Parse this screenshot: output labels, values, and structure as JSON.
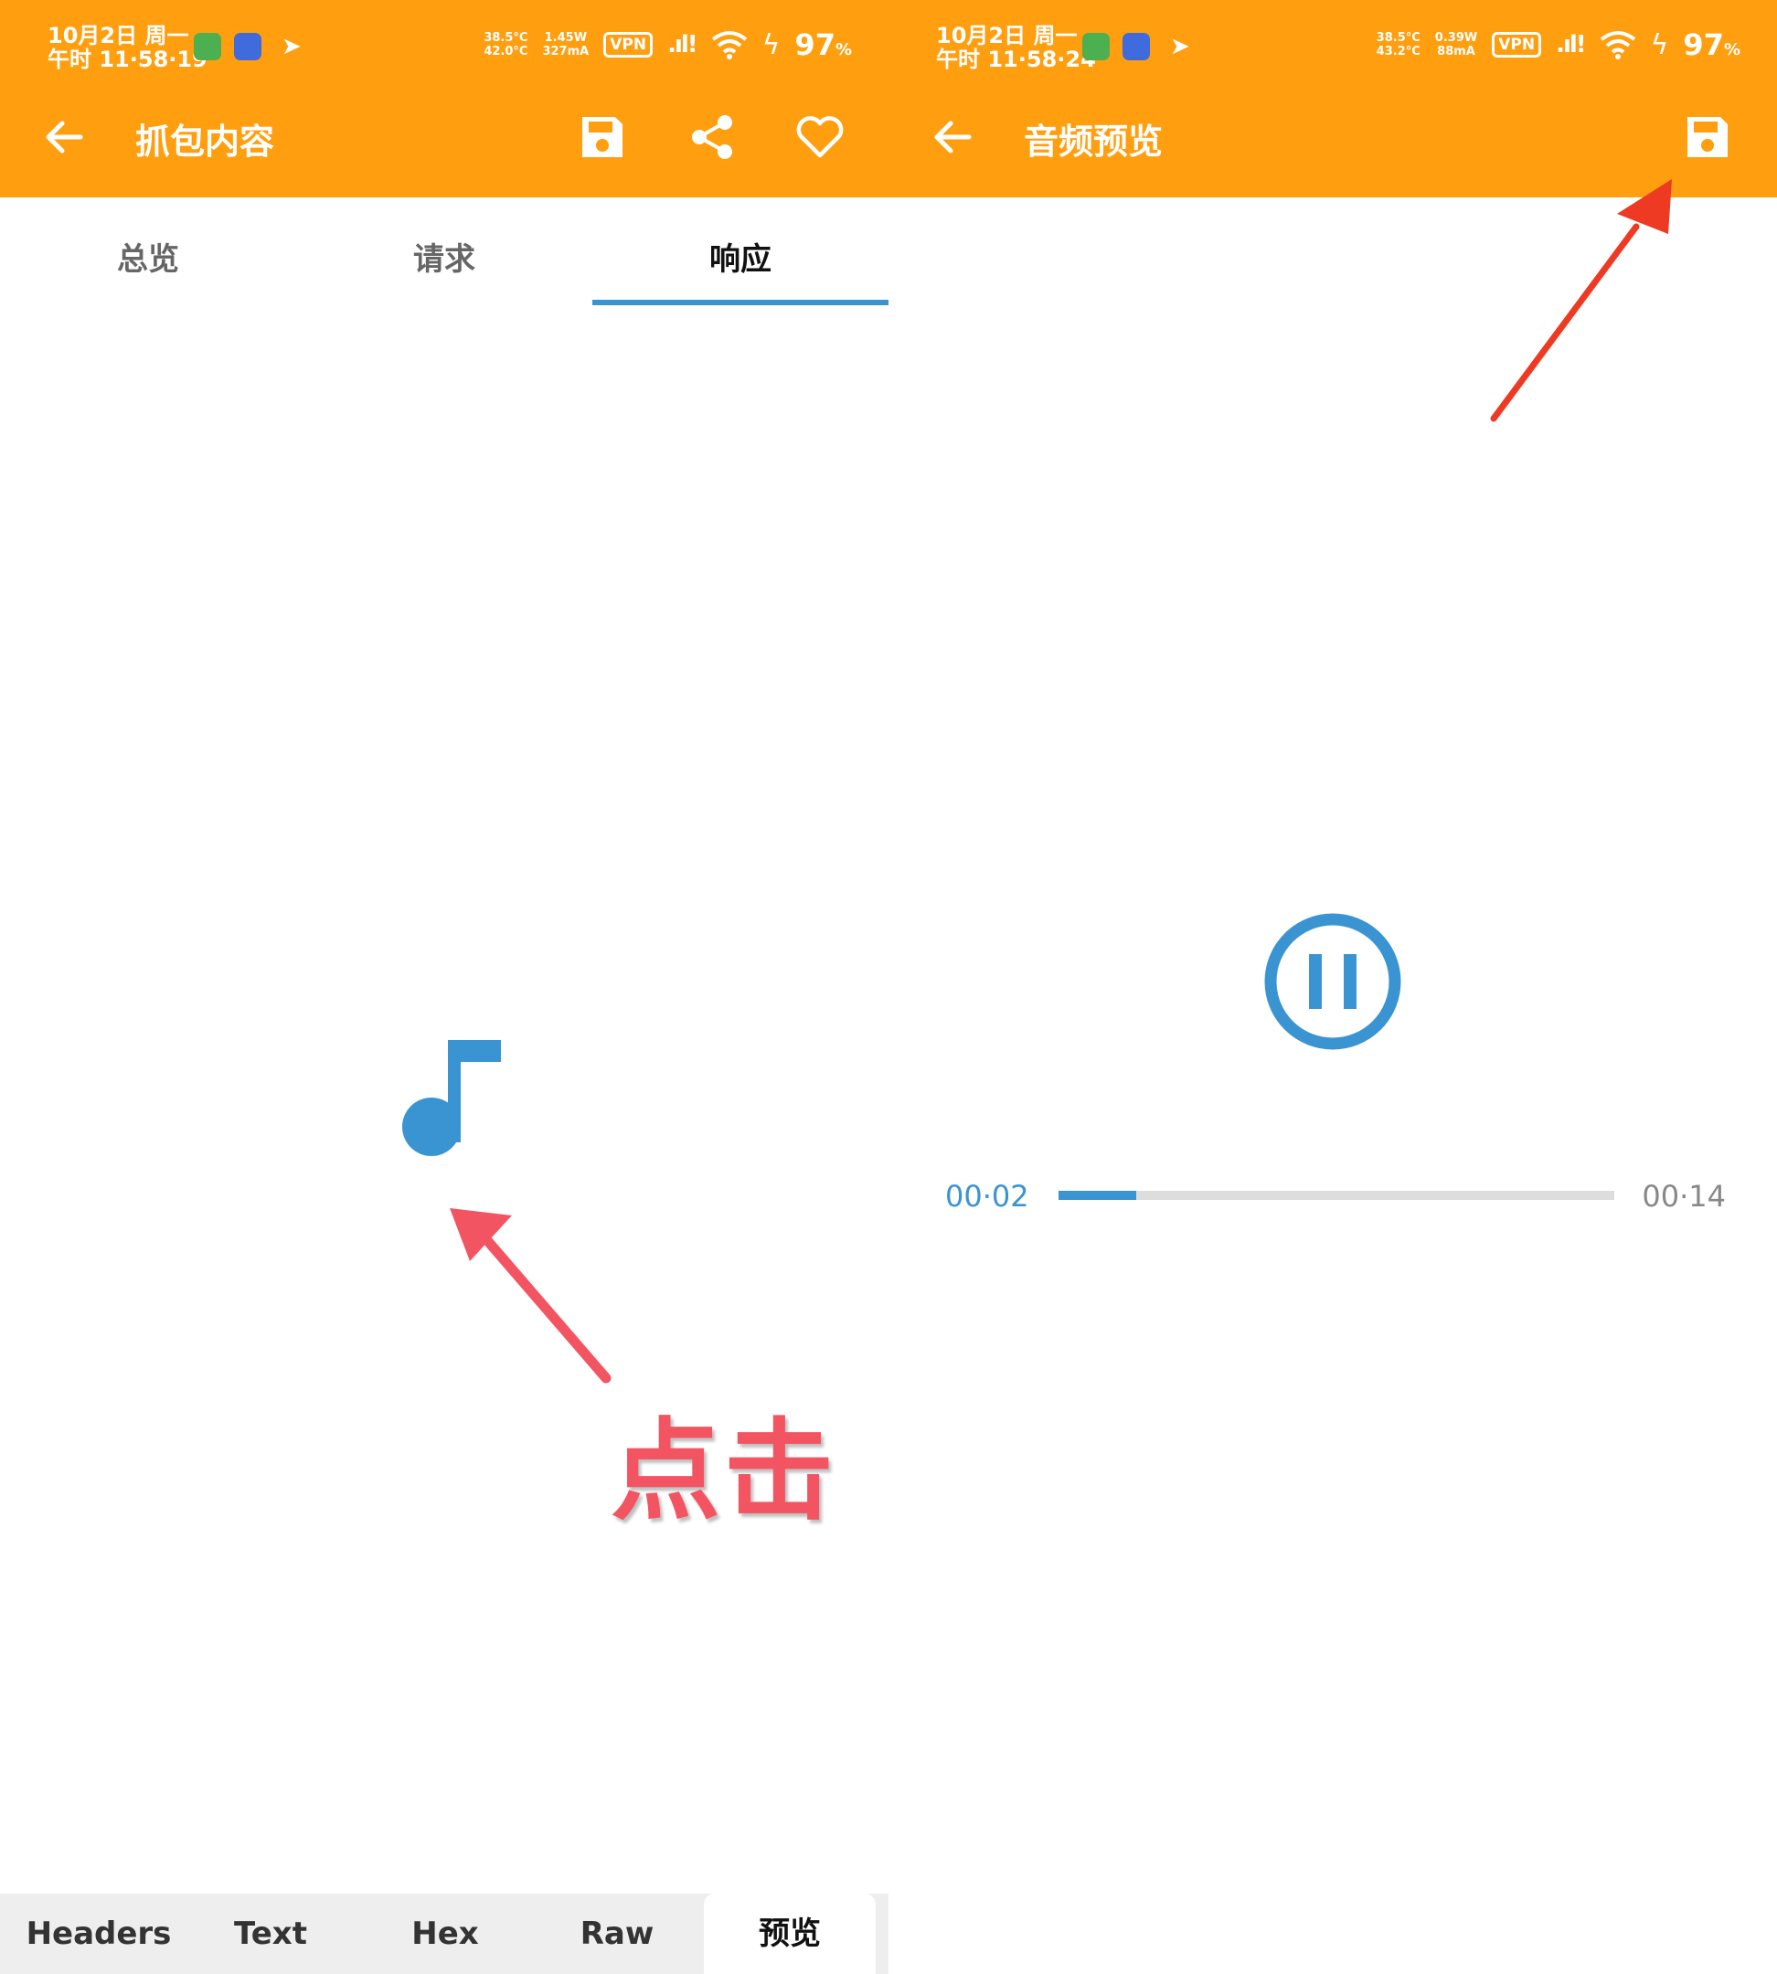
{
  "left": {
    "status": {
      "date": "10月2日 周一",
      "time": "午时 11·58·19",
      "temp": [
        "38.5°C",
        "42.0°C"
      ],
      "power": [
        "1.45W",
        "327mA"
      ],
      "vpn": "VPN",
      "battery": "97",
      "battery_unit": "%"
    },
    "toolbar": {
      "title": "抓包内容"
    },
    "tabs": [
      "总览",
      "请求",
      "响应"
    ],
    "annotation": "点击",
    "bottom_tabs": [
      "Headers",
      "Text",
      "Hex",
      "Raw",
      "预览"
    ]
  },
  "right": {
    "status": {
      "date": "10月2日 周一",
      "time": "午时 11·58·24",
      "temp": [
        "38.5°C",
        "43.2°C"
      ],
      "power": [
        "0.39W",
        "88mA"
      ],
      "vpn": "VPN",
      "battery": "97",
      "battery_unit": "%"
    },
    "toolbar": {
      "title": "音频预览"
    },
    "player": {
      "current": "00·02",
      "total": "00·14",
      "progress": 0.14
    }
  },
  "colors": {
    "appbar": "#FF9E0F",
    "accent": "#3B94D2",
    "annotation": "#F25561",
    "annotation_arrow_right": "#EE3A22"
  },
  "icons": [
    "back-arrow-icon",
    "save-icon",
    "share-icon",
    "heart-icon",
    "music-note-icon",
    "pause-circle-icon"
  ]
}
